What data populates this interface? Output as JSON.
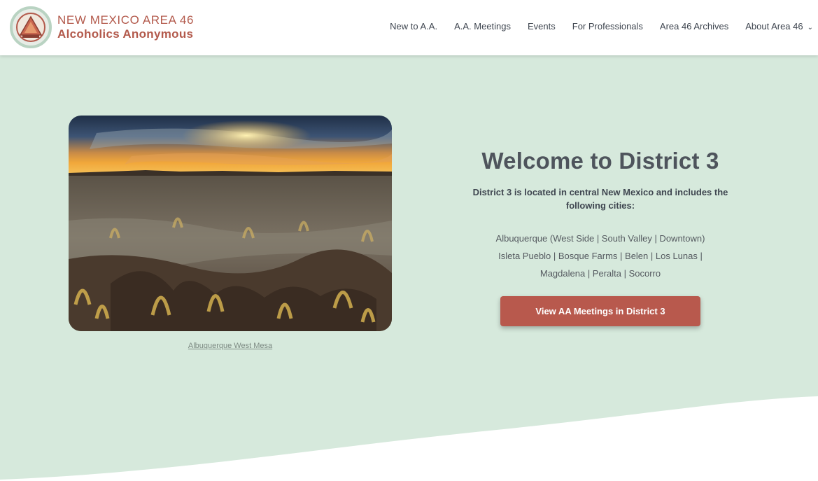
{
  "brand": {
    "line1": "NEW MEXICO AREA 46",
    "line2": "Alcoholics Anonymous"
  },
  "nav": {
    "items": [
      "New to A.A.",
      "A.A. Meetings",
      "Events",
      "For Professionals",
      "Area 46 Archives",
      "About Area 46"
    ]
  },
  "hero": {
    "image_caption": "Albuquerque West Mesa",
    "title": "Welcome to District 3",
    "subtitle": "District 3 is located in central New Mexico and includes the following cities:",
    "cities_line1": "Albuquerque (West Side | South Valley | Downtown)",
    "cities_line2": "Isleta Pueblo | Bosque Farms | Belen | Los Lunas |",
    "cities_line3": "Magdalena | Peralta | Socorro",
    "cta_label": "View AA Meetings in District 3"
  },
  "colors": {
    "brand": "#b35a4c",
    "background": "#d6e9dc",
    "cta": "#b8594d",
    "heading": "#4e545c"
  }
}
